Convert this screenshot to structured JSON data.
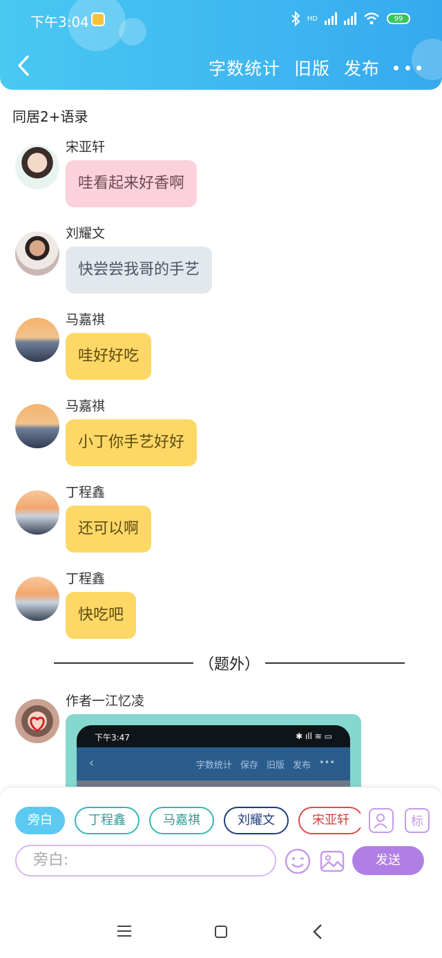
{
  "status_bar": {
    "time": "下午3:04",
    "network": "HD",
    "battery": "99"
  },
  "header": {
    "actions": [
      "字数统计",
      "旧版",
      "发布"
    ]
  },
  "chat": {
    "title": "同居2+语录",
    "messages": [
      {
        "name": "宋亚轩",
        "text": "哇看起来好香啊",
        "bubble_color": "#fbd1dc"
      },
      {
        "name": "刘耀文",
        "text": "快尝尝我哥的手艺",
        "bubble_color": "#e3e7ee"
      },
      {
        "name": "马嘉祺",
        "text": "哇好好吃",
        "bubble_color": "#fdd866"
      },
      {
        "name": "马嘉祺",
        "text": "小丁你手艺好好",
        "bubble_color": "#fdd866"
      },
      {
        "name": "丁程鑫",
        "text": "还可以啊",
        "bubble_color": "#fdd866"
      },
      {
        "name": "丁程鑫",
        "text": "快吃吧",
        "bubble_color": "#fdd866"
      }
    ],
    "divider": "（题外）",
    "author": {
      "name": "作者一江忆凌",
      "screenshot": {
        "time": "下午3:47",
        "actions": [
          "字数统计",
          "保存",
          "旧版",
          "发布"
        ]
      }
    }
  },
  "composer": {
    "chips": [
      "旁白",
      "丁程鑫",
      "马嘉祺",
      "刘耀文",
      "宋亚轩"
    ],
    "label_button": "标",
    "input_placeholder": "旁白:",
    "send_label": "发送"
  },
  "colors": {
    "header": "#3fb6f0",
    "send": "#b07fe6",
    "bubble_yellow": "#fdd866",
    "bubble_pink": "#fbd1dc",
    "bubble_gray": "#e3e7ee"
  }
}
